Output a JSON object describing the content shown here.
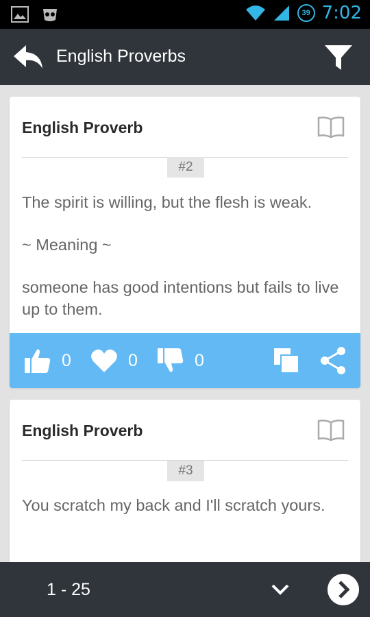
{
  "status_bar": {
    "time": "7:02",
    "battery_level": "39",
    "icons": [
      "gallery-icon",
      "incognito-icon",
      "wifi-icon",
      "signal-icon",
      "battery-icon"
    ]
  },
  "app_bar": {
    "title": "English Proverbs",
    "icons": [
      "back-arrow-icon",
      "filter-icon"
    ]
  },
  "cards": [
    {
      "heading": "English Proverb",
      "number": "#2",
      "proverb": "The spirit is willing, but the flesh is weak.",
      "meaning_label": "~ Meaning ~",
      "meaning": "someone has good intentions but fails to live up to them.",
      "likes": "0",
      "hearts": "0",
      "dislikes": "0"
    },
    {
      "heading": "English Proverb",
      "number": "#3",
      "proverb": "You scratch my back and I'll scratch yours."
    }
  ],
  "bottom_bar": {
    "range": "1 - 25"
  },
  "colors": {
    "action_bar": "#62b9f3",
    "app_bar": "#2f353b",
    "status_time": "#33b5e5"
  }
}
